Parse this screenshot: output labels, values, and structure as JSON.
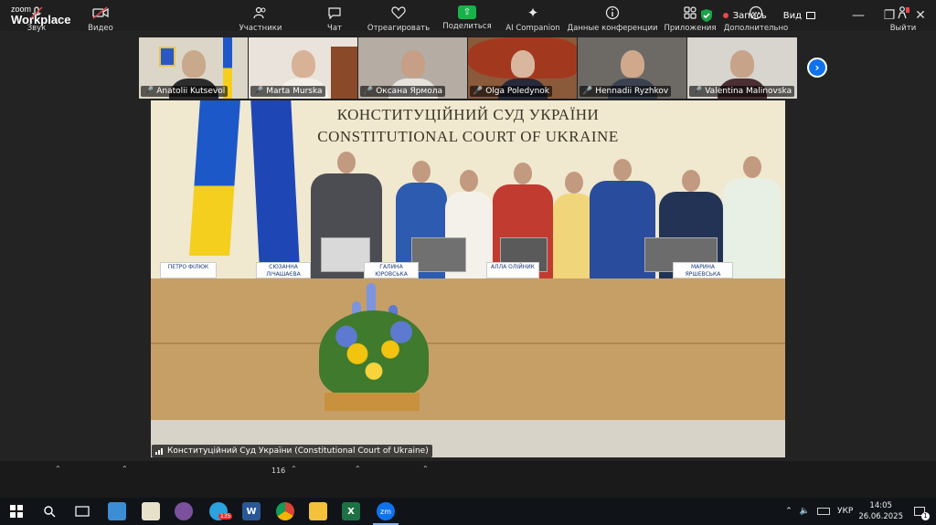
{
  "app": {
    "logo_line1": "zoom",
    "logo_line2": "Workplace"
  },
  "titlebar": {
    "record_label": "Запись",
    "view_label": "Вид"
  },
  "participants": [
    {
      "name": "Anatolii Kutsevol"
    },
    {
      "name": "Marta Murska"
    },
    {
      "name": "Оксана Ярмола"
    },
    {
      "name": "Olga Poledynok"
    },
    {
      "name": "Hennadii Ryzhkov"
    },
    {
      "name": "Valentina Malinovska"
    }
  ],
  "main_video": {
    "sign_line1": "КОНСТИТУЦІЙНИЙ СУД УКРАЇНИ",
    "sign_line2": "CONSTITUTIONAL COURT OF UKRAINE",
    "name_plates": [
      "ПЕТРО ФІЛЮК",
      "СЮЗАННА ЛІЧАШАЄВА",
      "ГАЛИНА ЮРОВСЬКА",
      "АЛЛА ОЛІЙНИК",
      "МАРИНА ЯРШЕВСЬКА"
    ],
    "speaker_label": "Конституційний Суд України (Constitutional Court of Ukraine)"
  },
  "toolbar": {
    "audio": "Звук",
    "video": "Видео",
    "participants": "Участники",
    "participants_count": "116",
    "chat": "Чат",
    "react": "Отреагировать",
    "share": "Поделиться",
    "ai": "AI Companion",
    "meeting_info": "Данные конференции",
    "apps": "Приложения",
    "more": "Дополнительно",
    "leave": "Выйти"
  },
  "taskbar": {
    "lang": "УКР",
    "time": "14:05",
    "date": "26.06.2025",
    "notif_count": "1",
    "badge_count": "135"
  },
  "colors": {
    "accent_blue": "#0e72ed",
    "share_green": "#18b24b",
    "record_red": "#e5484d"
  }
}
